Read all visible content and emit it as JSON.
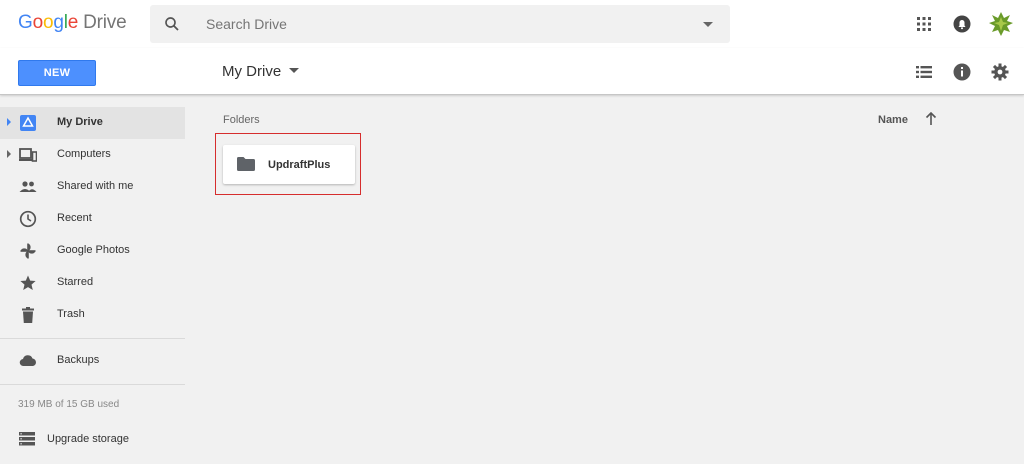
{
  "header": {
    "logo_google": [
      "G",
      "o",
      "o",
      "g",
      "l",
      "e"
    ],
    "logo_drive": "Drive",
    "search": {
      "placeholder": "Search Drive",
      "value": ""
    }
  },
  "toolbar": {
    "new_label": "NEW",
    "breadcrumb": "My Drive"
  },
  "sidebar": {
    "items": [
      {
        "label": "My Drive",
        "icon": "my-drive-icon"
      },
      {
        "label": "Computers",
        "icon": "computers-icon"
      },
      {
        "label": "Shared with me",
        "icon": "shared-with-me-icon"
      },
      {
        "label": "Recent",
        "icon": "recent-clock-icon"
      },
      {
        "label": "Google Photos",
        "icon": "google-photos-icon"
      },
      {
        "label": "Starred",
        "icon": "star-icon"
      },
      {
        "label": "Trash",
        "icon": "trash-icon"
      },
      {
        "label": "Backups",
        "icon": "cloud-icon"
      }
    ],
    "storage_text": "319 MB of 15 GB used",
    "upgrade_label": "Upgrade storage"
  },
  "main": {
    "folders_heading": "Folders",
    "sort_label": "Name",
    "folders": [
      {
        "name": "UpdraftPlus"
      }
    ]
  },
  "colors": {
    "new_button": "#4d90fe",
    "active_nav": "#e3e3e3",
    "highlight_box": "#d62d2d",
    "background": "#f1f1f1"
  }
}
